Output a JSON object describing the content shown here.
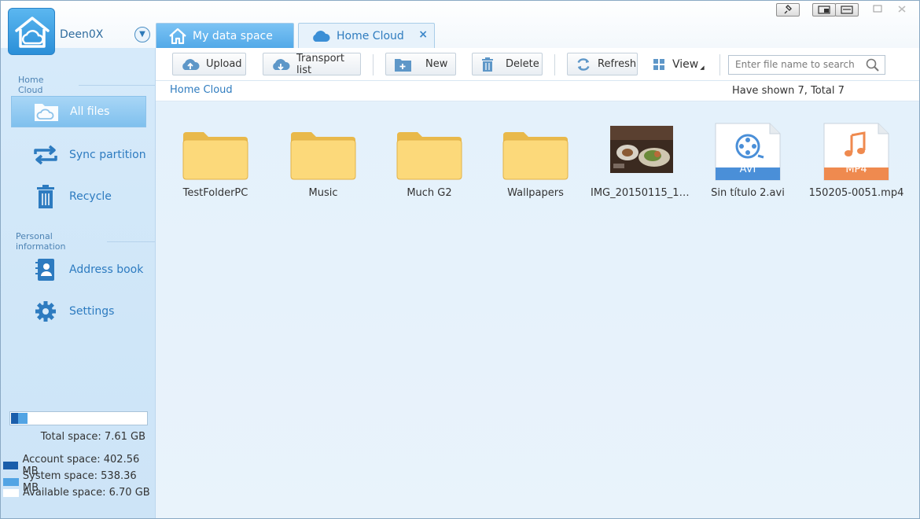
{
  "user": {
    "name": "Deen0X"
  },
  "tabs": [
    {
      "label": "My data space"
    },
    {
      "label": "Home Cloud",
      "close": "×"
    }
  ],
  "sidebar": {
    "section_home": "Home Cloud",
    "section_personal": "Personal information",
    "items": [
      {
        "label": "All files",
        "icon": "folder-cloud-icon",
        "active": true
      },
      {
        "label": "Sync partition",
        "icon": "sync-icon"
      },
      {
        "label": "Recycle",
        "icon": "trash-icon"
      },
      {
        "label": "Address book",
        "icon": "address-book-icon"
      },
      {
        "label": "Settings",
        "icon": "gear-icon"
      }
    ],
    "storage": {
      "account_fraction": 0.0516,
      "system_fraction": 0.069,
      "total": "Total space: 7.61 GB",
      "account": "Account space: 402.56 MB",
      "system": "System space: 538.36 MB",
      "available": "Available space: 6.70 GB"
    }
  },
  "toolbar": {
    "upload": "Upload",
    "transport": "Transport list",
    "new": "New",
    "delete": "Delete",
    "refresh": "Refresh",
    "view": "View",
    "search_placeholder": "Enter file name to search"
  },
  "breadcrumb": {
    "path": "Home Cloud",
    "count": "Have shown 7, Total 7"
  },
  "files": [
    {
      "name": "TestFolderPC",
      "type": "folder"
    },
    {
      "name": "Music",
      "type": "folder"
    },
    {
      "name": "Much G2",
      "type": "folder"
    },
    {
      "name": "Wallpapers",
      "type": "folder"
    },
    {
      "name": "IMG_20150115_10...",
      "type": "image"
    },
    {
      "name": "Sin título 2.avi",
      "type": "video",
      "badge": "AVI"
    },
    {
      "name": "150205-0051.mp4",
      "type": "audio",
      "badge": "MP4"
    }
  ],
  "colors": {
    "accent": "#2f7cbf",
    "account_space": "#1a5eab",
    "system_space": "#52a4e4",
    "available_space": "#ffffff",
    "avi_badge": "#4a8fd8",
    "mp4_badge": "#ef8a4f"
  }
}
